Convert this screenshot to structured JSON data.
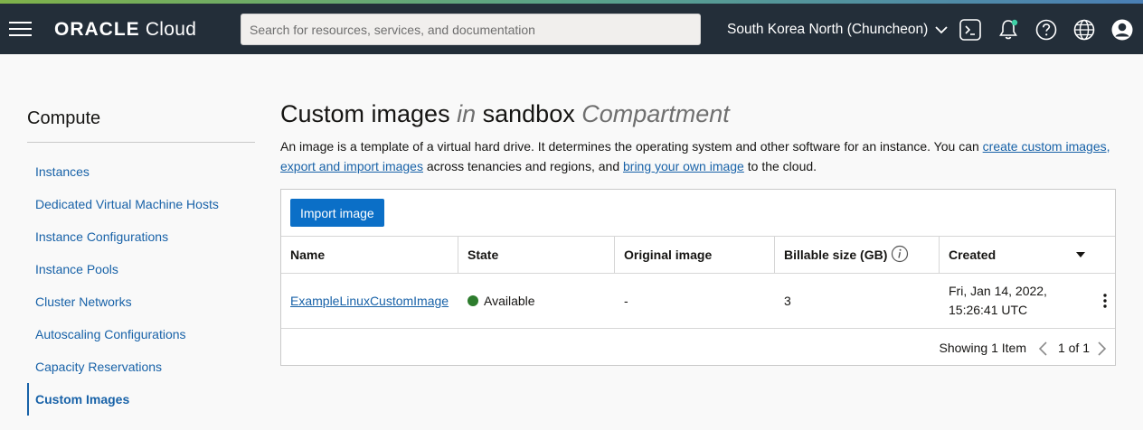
{
  "colors": {
    "topbar": "#232e39",
    "link": "#1862a8",
    "primary_button": "#0b6fc7",
    "status_available": "#2d7c2d"
  },
  "header": {
    "brand_bold": "ORACLE",
    "brand_light": "Cloud",
    "search_placeholder": "Search for resources, services, and documentation",
    "region": "South Korea North (Chuncheon)",
    "icons": [
      "menu-icon",
      "cloud-shell-icon",
      "notifications-icon",
      "help-icon",
      "language-globe-icon",
      "user-avatar-icon"
    ]
  },
  "sidebar": {
    "title": "Compute",
    "items": [
      {
        "label": "Instances"
      },
      {
        "label": "Dedicated Virtual Machine Hosts"
      },
      {
        "label": "Instance Configurations"
      },
      {
        "label": "Instance Pools"
      },
      {
        "label": "Cluster Networks"
      },
      {
        "label": "Autoscaling Configurations"
      },
      {
        "label": "Capacity Reservations"
      },
      {
        "label": "Custom Images"
      }
    ],
    "active": "Custom Images"
  },
  "main": {
    "title_part1": "Custom images",
    "title_in": "in",
    "title_compartment": "sandbox",
    "title_suffix": "Compartment",
    "desc": {
      "t1": "An image is a template of a virtual hard drive. It determines the operating system and other software for an instance. You can ",
      "link1": "create custom images,",
      "t2": "",
      "link2": "export and import images",
      "t3": " across tenancies and regions, and ",
      "link3": "bring your own image",
      "t4": " to the cloud."
    },
    "import_button": "Import image",
    "columns": {
      "name": "Name",
      "state": "State",
      "original": "Original image",
      "billable": "Billable size (GB)",
      "created": "Created"
    },
    "rows": [
      {
        "name": "ExampleLinuxCustomImage",
        "state": "Available",
        "original": "-",
        "billable": "3",
        "created_line1": "Fri, Jan 14, 2022,",
        "created_line2": "15:26:41 UTC"
      }
    ],
    "footer": {
      "showing": "Showing 1 Item",
      "page": "1 of 1"
    }
  }
}
